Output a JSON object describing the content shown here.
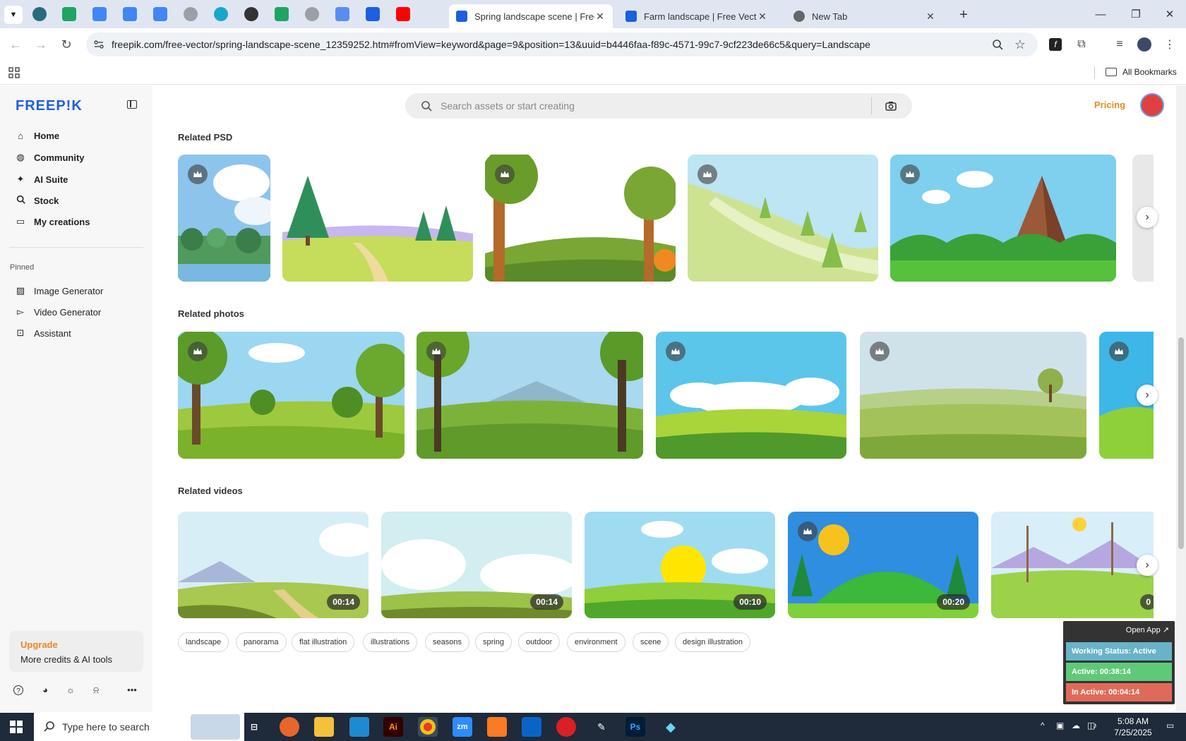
{
  "browser": {
    "tabs": [
      {
        "title": "Spring landscape scene | Free V",
        "active": true,
        "favicon_color": "#1d5fe0"
      },
      {
        "title": "Farm landscape | Free Vector",
        "active": false,
        "favicon_color": "#1d5fe0"
      },
      {
        "title": "New Tab",
        "active": false,
        "favicon_color": "#666666"
      }
    ],
    "new_tab_symbol": "+",
    "url": "freepik.com/free-vector/spring-landscape-scene_12359252.htm#fromView=keyword&page=9&position=13&uuid=b4446faa-f89c-4571-99c7-9cf223de66c5&query=Landscape",
    "bookmarks_label": "All Bookmarks"
  },
  "sidebar": {
    "logo": "FREEP!K",
    "nav": [
      {
        "label": "Home",
        "icon": "home-icon"
      },
      {
        "label": "Community",
        "icon": "globe-icon"
      },
      {
        "label": "AI Suite",
        "icon": "sparkle-icon"
      },
      {
        "label": "Stock",
        "icon": "search-icon"
      },
      {
        "label": "My creations",
        "icon": "folder-icon"
      }
    ],
    "pinned_label": "Pinned",
    "pinned": [
      {
        "label": "Image Generator",
        "icon": "image-icon"
      },
      {
        "label": "Video Generator",
        "icon": "video-icon"
      },
      {
        "label": "Assistant",
        "icon": "chat-icon"
      }
    ],
    "upgrade": {
      "title": "Upgrade",
      "subtitle": "More credits & AI tools"
    }
  },
  "header": {
    "search_placeholder": "Search assets or start creating",
    "pricing": "Pricing"
  },
  "sections": {
    "psd": {
      "title": "Related PSD"
    },
    "photos": {
      "title": "Related photos"
    },
    "videos": {
      "title": "Related videos",
      "durations": [
        "00:14",
        "00:14",
        "00:10",
        "00:20",
        "0"
      ]
    }
  },
  "tags": [
    "landscape",
    "panorama",
    "flat illustration",
    "illustrations",
    "seasons",
    "spring",
    "outdoor",
    "environment",
    "scene",
    "design illustration"
  ],
  "tracker": {
    "open_app": "Open App ↗",
    "working_status": "Working Status: Active",
    "active": "Active: 00:38:14",
    "inactive": "In Active: 00:04:14",
    "colors": {
      "working": "#69b3c8",
      "active": "#5fc97a",
      "inactive": "#e06a5a"
    }
  },
  "taskbar": {
    "search_placeholder": "Type here to search",
    "time": "5:08 AM",
    "date": "7/25/2025",
    "apps": [
      "task-view",
      "firefox",
      "file-explorer",
      "vscode",
      "illustrator",
      "chrome",
      "zoom",
      "xampp",
      "outlook",
      "creative-cloud",
      "pen-tool",
      "photoshop",
      "app"
    ]
  }
}
